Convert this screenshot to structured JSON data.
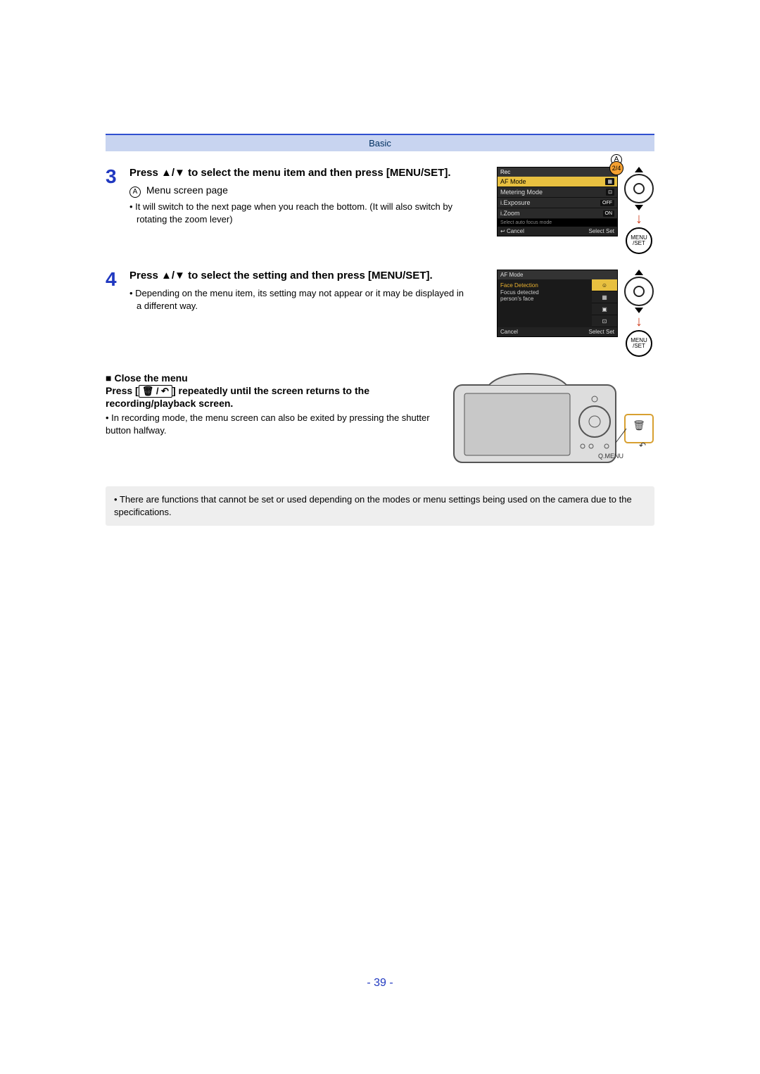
{
  "header": {
    "section": "Basic"
  },
  "step3": {
    "num": "3",
    "heading_a": "Press ",
    "heading_arrows": "▲/▼",
    "heading_b": " to select the menu item and then press [MENU/SET].",
    "sublabel_letter": "A",
    "sublabel_text": "Menu screen page",
    "bullet1": "It will switch to the next page when you reach the bottom. (It will also switch by rotating the zoom lever)",
    "marker_A": "A",
    "menu": {
      "tab": "Rec",
      "items": [
        {
          "label": "AF Mode",
          "value": ""
        },
        {
          "label": "Metering Mode",
          "value": ""
        },
        {
          "label": "i.Exposure",
          "value": "OFF"
        },
        {
          "label": "i.Zoom",
          "value": "ON"
        }
      ],
      "hint": "Select auto focus mode",
      "footer_cancel": "Cancel",
      "footer_select": "Select",
      "footer_set": "Set",
      "page_badge": "2/4"
    },
    "control": {
      "menu_set": "MENU /SET"
    }
  },
  "step4": {
    "num": "4",
    "heading_a": "Press ",
    "heading_arrows": "▲/▼",
    "heading_b": " to select the setting and then press [MENU/SET].",
    "bullet1": "Depending on the menu item, its setting may not appear or it may be displayed in a different way.",
    "screen": {
      "title": "AF Mode",
      "desc_l1": "Face Detection",
      "desc_l2": "Focus detected",
      "desc_l3": "person's face",
      "options_count": 4,
      "footer_cancel": "Cancel",
      "footer_select": "Select",
      "footer_set": "Set"
    },
    "control": {
      "menu_set": "MENU /SET"
    }
  },
  "close": {
    "title": "Close the menu",
    "line2a": "Press [",
    "line2b": "] repeatedly until the screen returns to the recording/playback screen.",
    "note": "In recording mode, the menu screen can also be exited by pressing the shutter button halfway.",
    "qmenu_label": "Q.MENU"
  },
  "bottom_note": "There are functions that cannot be set or used depending on the modes or menu settings being used on the camera due to the specifications.",
  "page_number": "- 39 -"
}
